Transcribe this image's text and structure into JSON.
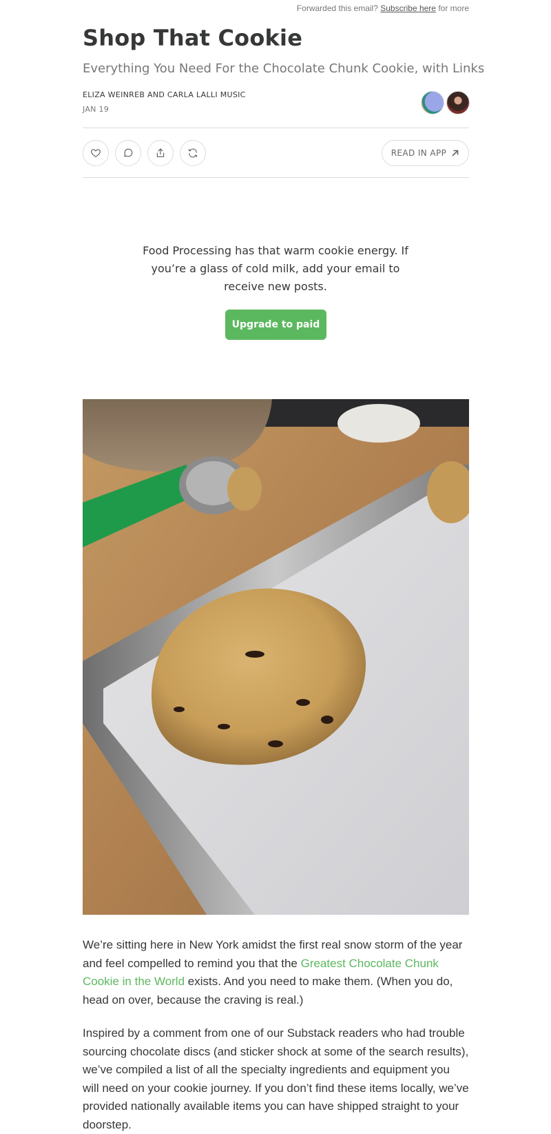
{
  "header": {
    "forwarded_prefix": "Forwarded this email?",
    "subscribe_link": "Subscribe here",
    "forwarded_suffix": "for more"
  },
  "post": {
    "title": "Shop That Cookie",
    "subtitle": "Everything You Need For the Chocolate Chunk Cookie, with Links",
    "authors": "ELIZA WEINREB AND CARLA LALLI MUSIC",
    "date": "JAN 19"
  },
  "actions": {
    "read_in_app_label": "READ IN APP",
    "icons": [
      "heart-icon",
      "comment-icon",
      "share-icon",
      "restack-icon",
      "arrow-up-right-icon"
    ]
  },
  "promo": {
    "text": "Food Processing has that warm cookie energy. If you’re a glass of cold milk, add your email to receive new posts.",
    "button_label": "Upgrade to paid",
    "button_color": "#5cb85f"
  },
  "image": {
    "alt": "Scoop of chocolate chunk cookie dough on a lined sheet pan"
  },
  "body": {
    "p1_before": "We’re sitting here in New York amidst the first real snow storm of the year and feel compelled to remind you that the ",
    "p1_link": "Greatest Chocolate Chunk Cookie in the World",
    "p1_after": " exists. And you need to make them. (When you do, head on over, because the craving is real.)",
    "p2": "Inspired by a comment from one of our Substack readers who had trouble sourcing chocolate discs (and sticker shock at some of the search results), we’ve compiled a list of all the specialty ingredients and equipment you will need on your cookie journey. If you don’t find these items locally, we’ve provided nationally available items you can have shipped straight to your doorstep."
  },
  "colors": {
    "link": "#5cb85f",
    "text": "#363737",
    "muted": "#777777"
  }
}
